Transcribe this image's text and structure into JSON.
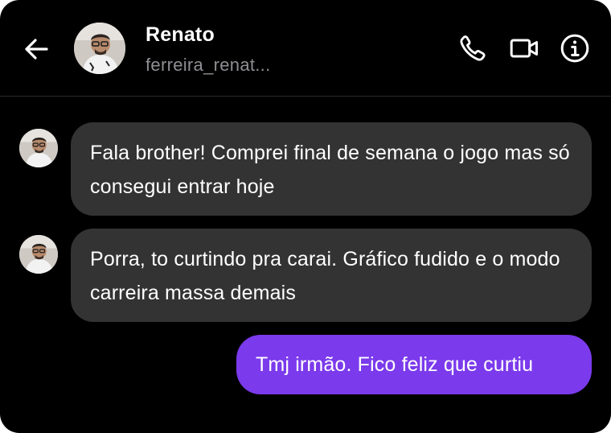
{
  "header": {
    "back_icon": "arrow-left-icon",
    "contact_name": "Renato",
    "contact_username": "ferreira_renat...",
    "actions": [
      {
        "name": "phone-icon"
      },
      {
        "name": "video-camera-icon"
      },
      {
        "name": "info-icon"
      }
    ]
  },
  "messages": [
    {
      "direction": "incoming",
      "text": "Fala brother! Comprei final de semana o jogo mas só consegui entrar hoje"
    },
    {
      "direction": "incoming",
      "text": "Porra, to curtindo pra carai. Gráfico fudido e o modo carreira massa demais"
    },
    {
      "direction": "outgoing",
      "text": "Tmj irmão. Fico feliz que curtiu"
    }
  ],
  "colors": {
    "background": "#000000",
    "incoming_bubble": "#333333",
    "outgoing_bubble": "#7b3aec",
    "username": "#8e8e93"
  }
}
